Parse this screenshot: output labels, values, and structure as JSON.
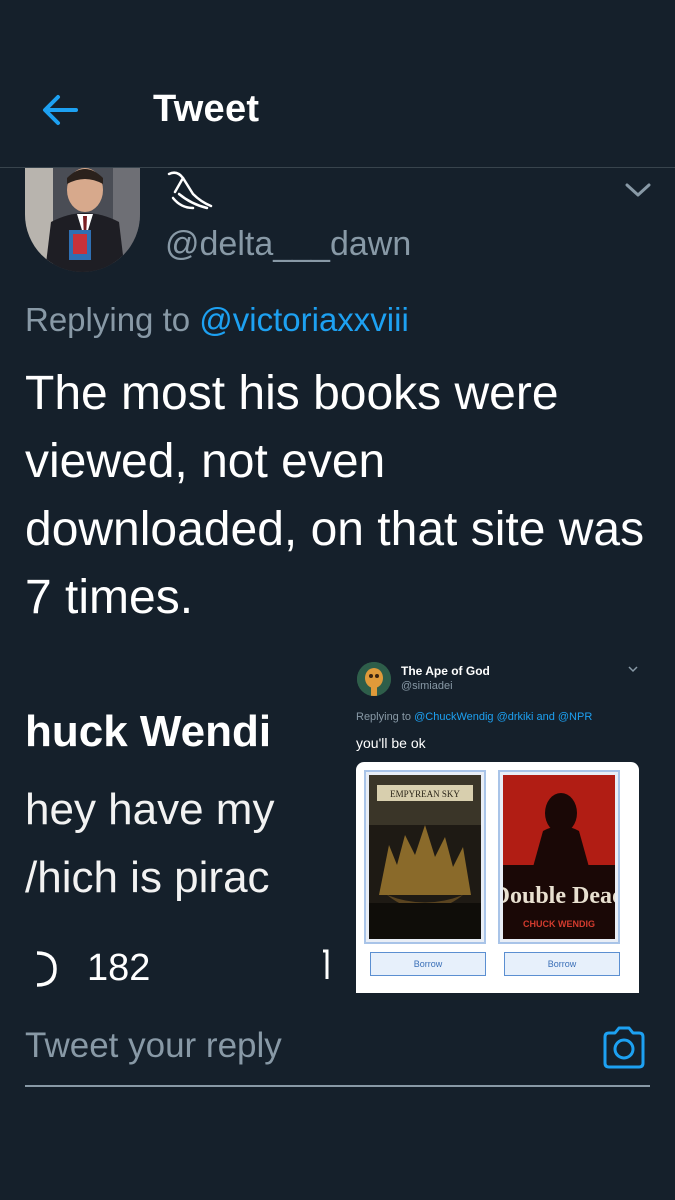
{
  "header": {
    "title": "Tweet",
    "back_icon": "arrow-left-icon"
  },
  "tweet": {
    "handle": "@delta___dawn",
    "replying_prefix": "Replying to ",
    "replying_mention": "@victoriaxxviii",
    "text": "The most his books were viewed, not even downloaded, on that site was 7 times."
  },
  "embedded_left": {
    "name": "huck Wendi",
    "line1": "hey have my",
    "line2": "/hich is pirac",
    "reply_count": "182"
  },
  "embedded_right": {
    "name": "The Ape of God",
    "handle": "@simiadei",
    "replying_prefix": "Replying to ",
    "mentions": "@ChuckWendig @drkiki and @NPR",
    "text": "you'll be ok",
    "books": [
      {
        "title": "EMPYREAN SKY",
        "button": "Borrow"
      },
      {
        "title": "Double Dead",
        "author": "CHUCK WENDIG",
        "button": "Borrow"
      }
    ]
  },
  "reply": {
    "placeholder": "Tweet your reply",
    "icon": "camera-icon"
  },
  "colors": {
    "background": "#15202b",
    "accent": "#1da1f2",
    "muted": "#8899a6",
    "divider": "#38444d"
  }
}
